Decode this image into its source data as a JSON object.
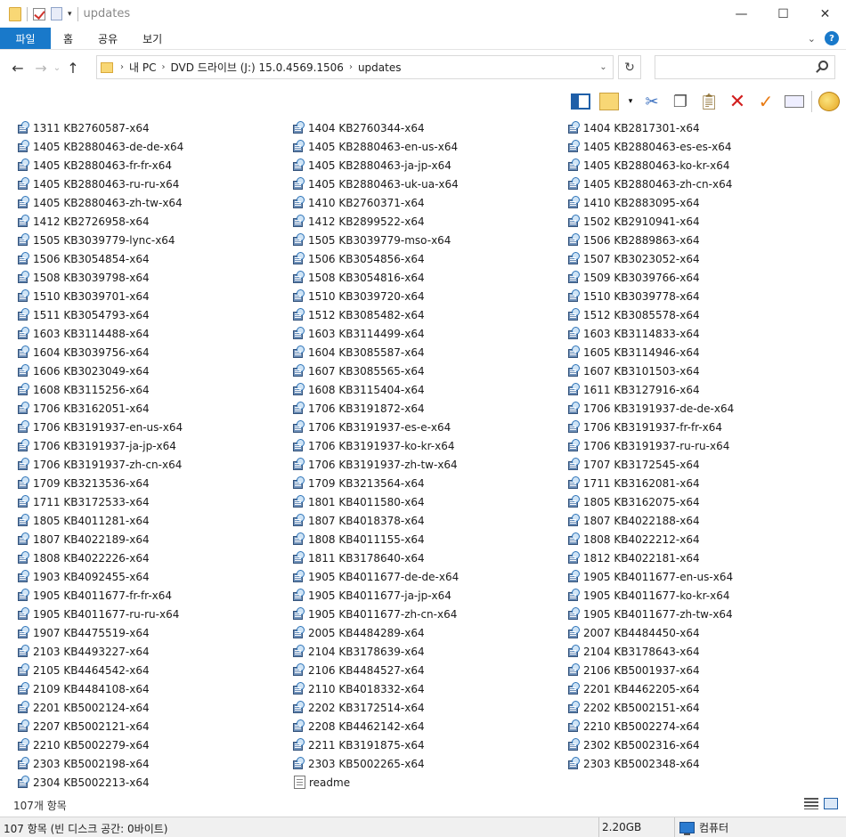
{
  "window": {
    "title": "updates",
    "minimize_glyph": "—",
    "maximize_glyph": "☐",
    "close_glyph": "✕"
  },
  "ribbon": {
    "tabs": [
      "파일",
      "홈",
      "공유",
      "보기"
    ]
  },
  "address": {
    "crumbs": [
      "내 PC",
      "DVD 드라이브 (J:) 15.0.4569.1506",
      "updates"
    ],
    "search_placeholder": ""
  },
  "toolbar_icons": [
    "pane-icon",
    "view-icon",
    "cut-icon",
    "copy-icon",
    "paste-icon",
    "delete-icon",
    "check-icon",
    "mail-icon",
    "shell-icon"
  ],
  "columns": [
    [
      "1311 KB2760587-x64",
      "1405 KB2880463-de-de-x64",
      "1405 KB2880463-fr-fr-x64",
      "1405 KB2880463-ru-ru-x64",
      "1405 KB2880463-zh-tw-x64",
      "1412 KB2726958-x64",
      "1505 KB3039779-lync-x64",
      "1506 KB3054854-x64",
      "1508 KB3039798-x64",
      "1510 KB3039701-x64",
      "1511 KB3054793-x64",
      "1603 KB3114488-x64",
      "1604 KB3039756-x64",
      "1606 KB3023049-x64",
      "1608 KB3115256-x64",
      "1706 KB3162051-x64",
      "1706 KB3191937-en-us-x64",
      "1706 KB3191937-ja-jp-x64",
      "1706 KB3191937-zh-cn-x64",
      "1709 KB3213536-x64",
      "1711 KB3172533-x64",
      "1805 KB4011281-x64",
      "1807 KB4022189-x64",
      "1808 KB4022226-x64",
      "1903 KB4092455-x64",
      "1905 KB4011677-fr-fr-x64",
      "1905 KB4011677-ru-ru-x64",
      "1907 KB4475519-x64",
      "2103 KB4493227-x64",
      "2105 KB4464542-x64",
      "2109 KB4484108-x64",
      "2201 KB5002124-x64",
      "2207 KB5002121-x64",
      "2210 KB5002279-x64",
      "2303 KB5002198-x64",
      "2304 KB5002213-x64"
    ],
    [
      "1404 KB2760344-x64",
      "1405 KB2880463-en-us-x64",
      "1405 KB2880463-ja-jp-x64",
      "1405 KB2880463-uk-ua-x64",
      "1410 KB2760371-x64",
      "1412 KB2899522-x64",
      "1505 KB3039779-mso-x64",
      "1506 KB3054856-x64",
      "1508 KB3054816-x64",
      "1510 KB3039720-x64",
      "1512 KB3085482-x64",
      "1603 KB3114499-x64",
      "1604 KB3085587-x64",
      "1607 KB3085565-x64",
      "1608 KB3115404-x64",
      "1706 KB3191872-x64",
      "1706 KB3191937-es-e-x64",
      "1706 KB3191937-ko-kr-x64",
      "1706 KB3191937-zh-tw-x64",
      "1709 KB3213564-x64",
      "1801 KB4011580-x64",
      "1807 KB4018378-x64",
      "1808 KB4011155-x64",
      "1811 KB3178640-x64",
      "1905 KB4011677-de-de-x64",
      "1905 KB4011677-ja-jp-x64",
      "1905 KB4011677-zh-cn-x64",
      "2005 KB4484289-x64",
      "2104 KB3178639-x64",
      "2106 KB4484527-x64",
      "2110 KB4018332-x64",
      "2202 KB3172514-x64",
      "2208 KB4462142-x64",
      "2211 KB3191875-x64",
      "2303 KB5002265-x64",
      "readme"
    ],
    [
      "1404 KB2817301-x64",
      "1405 KB2880463-es-es-x64",
      "1405 KB2880463-ko-kr-x64",
      "1405 KB2880463-zh-cn-x64",
      "1410 KB2883095-x64",
      "1502 KB2910941-x64",
      "1506 KB2889863-x64",
      "1507 KB3023052-x64",
      "1509 KB3039766-x64",
      "1510 KB3039778-x64",
      "1512 KB3085578-x64",
      "1603 KB3114833-x64",
      "1605 KB3114946-x64",
      "1607 KB3101503-x64",
      "1611 KB3127916-x64",
      "1706 KB3191937-de-de-x64",
      "1706 KB3191937-fr-fr-x64",
      "1706 KB3191937-ru-ru-x64",
      "1707 KB3172545-x64",
      "1711 KB3162081-x64",
      "1805 KB3162075-x64",
      "1807 KB4022188-x64",
      "1808 KB4022212-x64",
      "1812 KB4022181-x64",
      "1905 KB4011677-en-us-x64",
      "1905 KB4011677-ko-kr-x64",
      "1905 KB4011677-zh-tw-x64",
      "2007 KB4484450-x64",
      "2104 KB3178643-x64",
      "2106 KB5001937-x64",
      "2201 KB4462205-x64",
      "2202 KB5002151-x64",
      "2210 KB5002274-x64",
      "2302 KB5002316-x64",
      "2303 KB5002348-x64"
    ]
  ],
  "item_count": "107개 항목",
  "status": {
    "left": "107 항목 (빈 디스크 공간: 0바이트)",
    "size": "2.20GB",
    "location": "컴퓨터"
  }
}
